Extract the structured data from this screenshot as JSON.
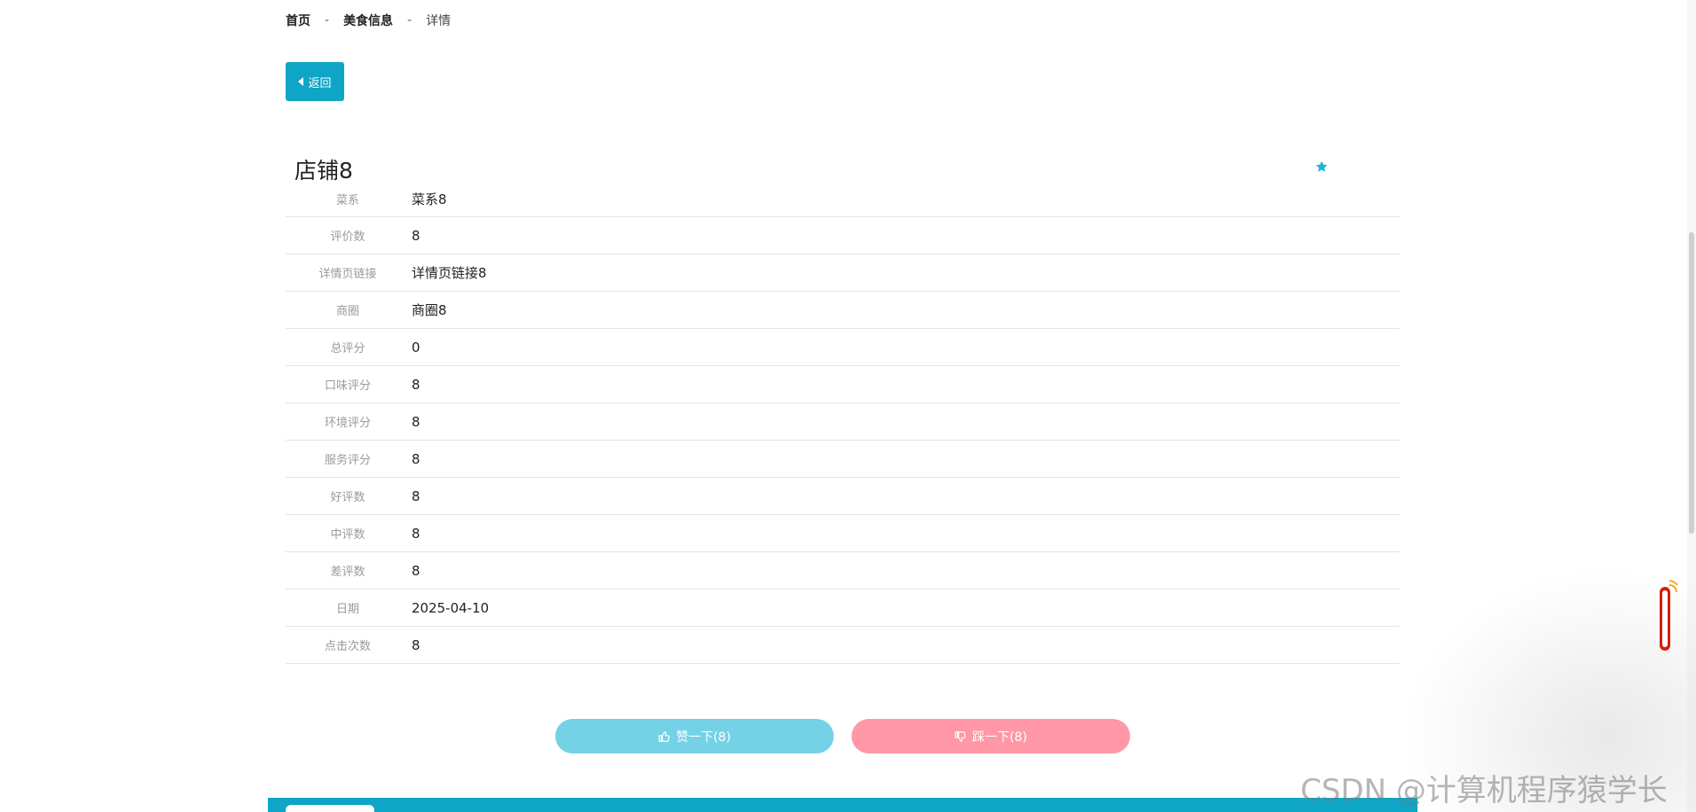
{
  "breadcrumb": {
    "home": "首页",
    "section": "美食信息",
    "current": "详情",
    "separator": "-"
  },
  "back_button": {
    "label": "返回"
  },
  "detail": {
    "title": "店铺8",
    "rows": [
      {
        "label": "菜系",
        "value": "菜系8"
      },
      {
        "label": "评价数",
        "value": "8"
      },
      {
        "label": "详情页链接",
        "value": "详情页链接8"
      },
      {
        "label": "商圈",
        "value": "商圈8"
      },
      {
        "label": "总评分",
        "value": "0"
      },
      {
        "label": "口味评分",
        "value": "8"
      },
      {
        "label": "环境评分",
        "value": "8"
      },
      {
        "label": "服务评分",
        "value": "8"
      },
      {
        "label": "好评数",
        "value": "8"
      },
      {
        "label": "中评数",
        "value": "8"
      },
      {
        "label": "差评数",
        "value": "8"
      },
      {
        "label": "日期",
        "value": "2025-04-10"
      },
      {
        "label": "点击次数",
        "value": "8"
      }
    ]
  },
  "actions": {
    "like_label": "赞一下(8)",
    "dislike_label": "踩一下(8)"
  },
  "watermark": "CSDN @计算机程序猿学长",
  "colors": {
    "primary": "#0ea5c6",
    "like": "#74d1e6",
    "dislike": "#ff97a6",
    "star": "#1ab6d3"
  },
  "icons": {
    "back": "caret-left-icon",
    "favorite": "star-icon",
    "like": "thumbs-up-icon",
    "dislike": "thumbs-down-icon"
  }
}
